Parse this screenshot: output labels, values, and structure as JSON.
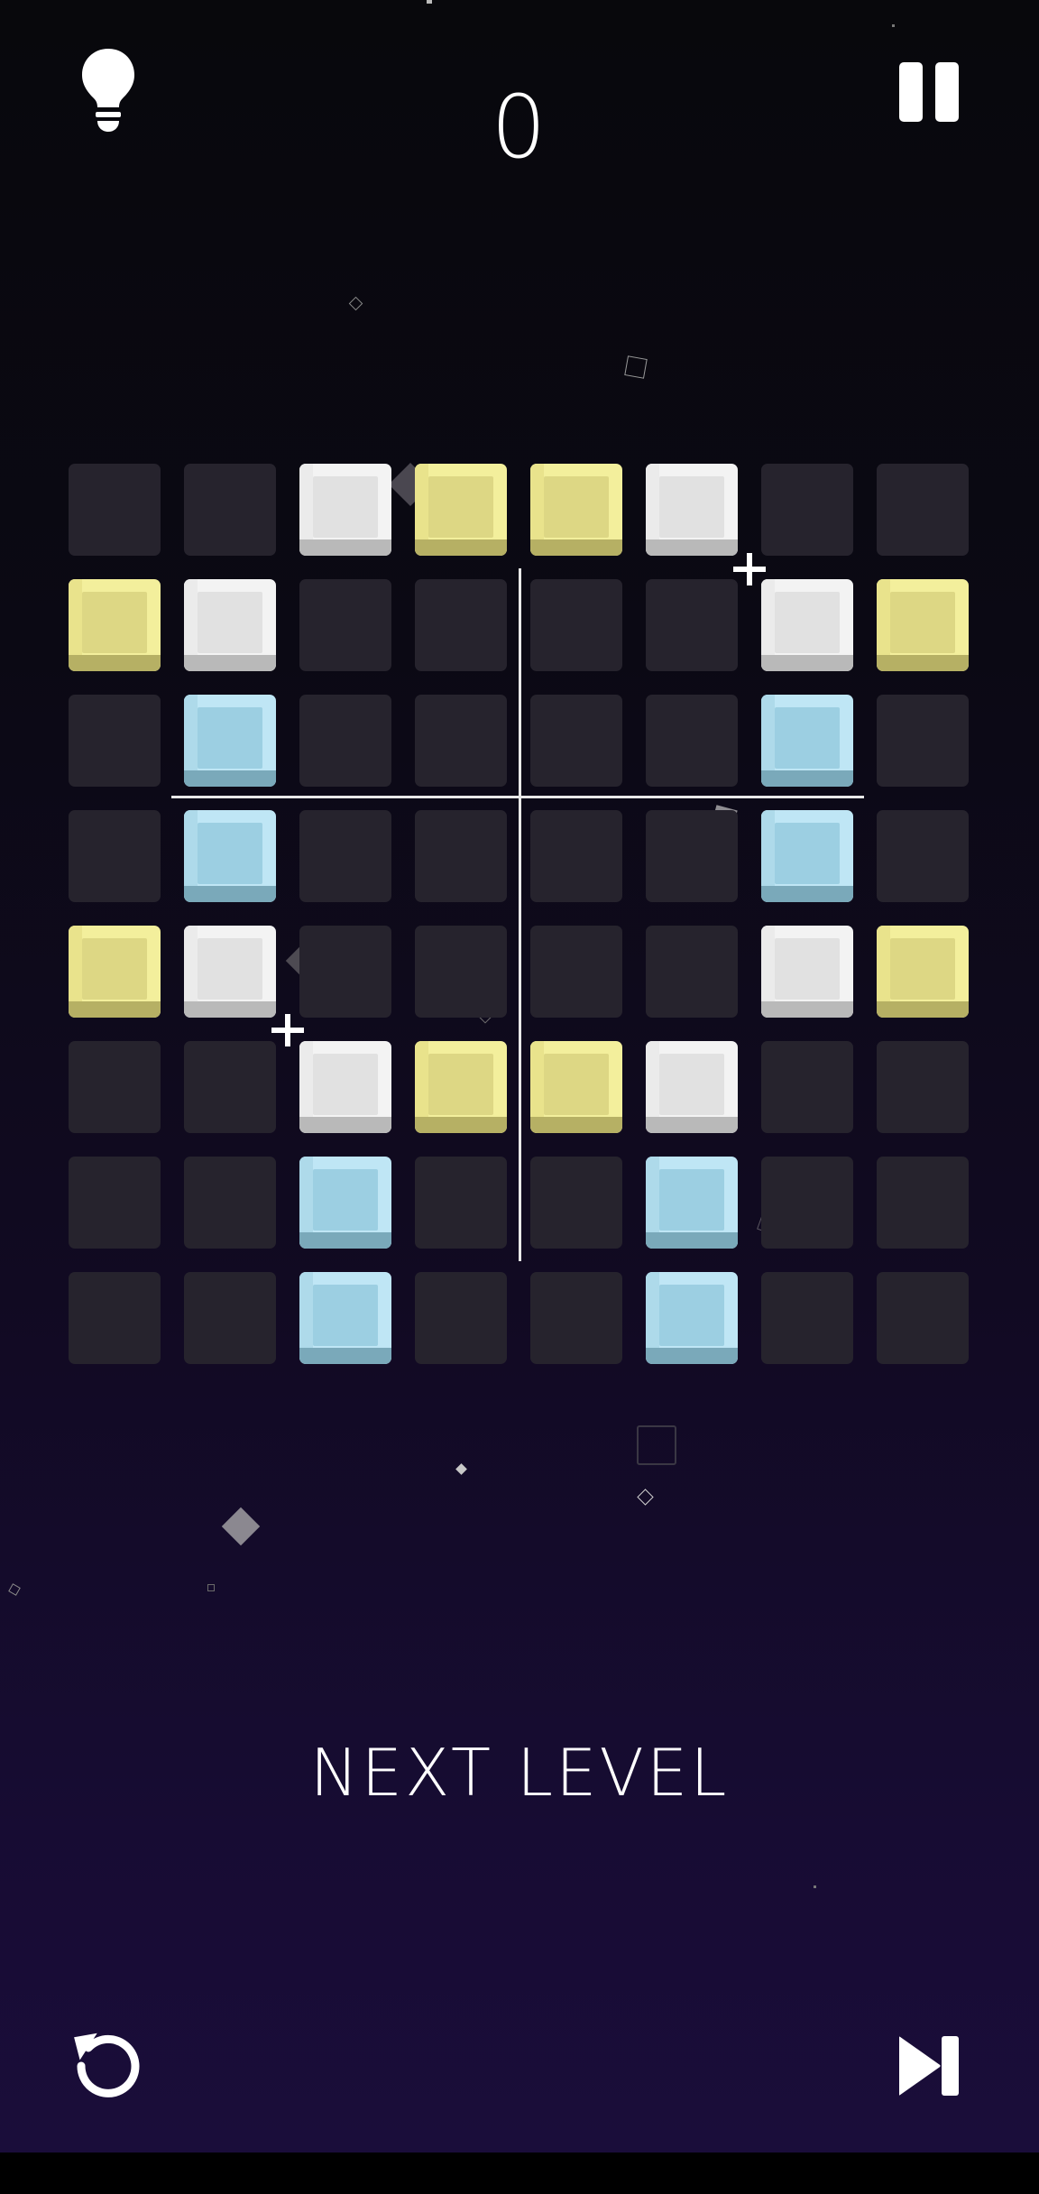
{
  "header": {
    "score": "0",
    "hint_icon": "lightbulb-icon",
    "pause_icon": "pause-icon"
  },
  "board": {
    "columns": 8,
    "rows": 8,
    "grid": [
      [
        "empty",
        "empty",
        "white",
        "yellow",
        "yellow",
        "white",
        "empty",
        "empty"
      ],
      [
        "yellow",
        "white",
        "empty",
        "empty",
        "empty",
        "empty",
        "white",
        "yellow"
      ],
      [
        "empty",
        "blue",
        "empty",
        "empty",
        "empty",
        "empty",
        "blue",
        "empty"
      ],
      [
        "empty",
        "blue",
        "empty",
        "empty",
        "empty",
        "empty",
        "blue",
        "empty"
      ],
      [
        "yellow",
        "white",
        "empty",
        "empty",
        "empty",
        "empty",
        "white",
        "yellow"
      ],
      [
        "empty",
        "empty",
        "white",
        "yellow",
        "yellow",
        "white",
        "empty",
        "empty"
      ],
      [
        "empty",
        "empty",
        "blue",
        "empty",
        "empty",
        "blue",
        "empty",
        "empty"
      ],
      [
        "empty",
        "empty",
        "blue",
        "empty",
        "empty",
        "blue",
        "empty",
        "empty"
      ]
    ],
    "colors": {
      "empty": "#26232d",
      "white": "#f3f3f3",
      "yellow": "#f3ef9c",
      "blue": "#bfe6f5"
    }
  },
  "actions": {
    "next_level_label": "NEXT LEVEL",
    "restart_icon": "restart-icon",
    "skip_icon": "skip-icon"
  },
  "theme": {
    "background_top": "#08080c",
    "background_bottom": "#1a0d3a",
    "text_color": "#ffffff"
  }
}
